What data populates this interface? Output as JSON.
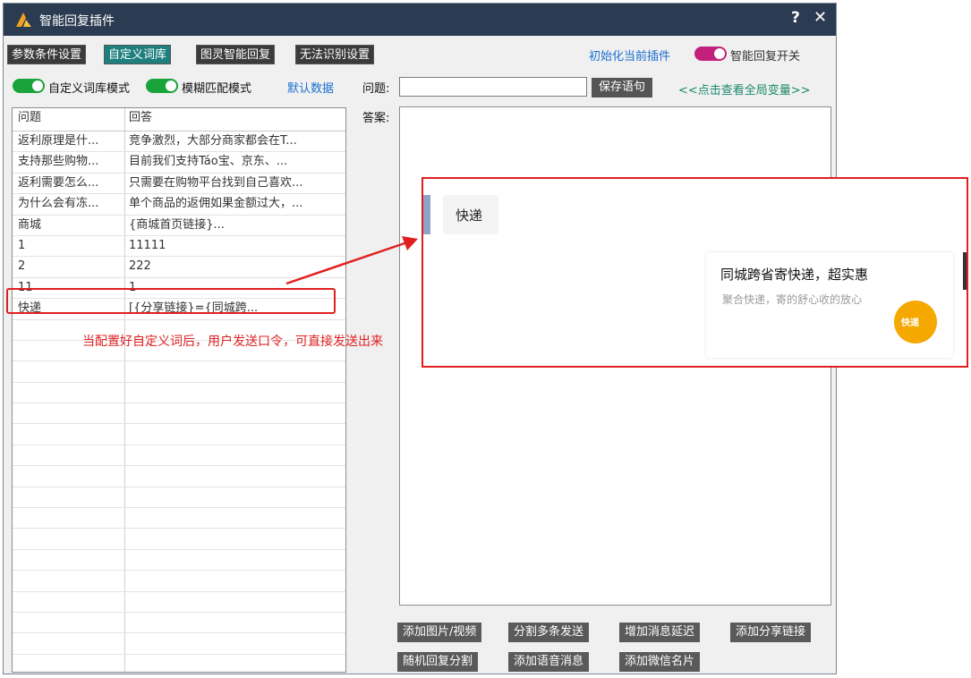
{
  "window": {
    "title": "智能回复插件",
    "help_glyph": "?",
    "close_glyph": "✕"
  },
  "tabs": [
    {
      "label": "参数条件设置",
      "active": false
    },
    {
      "label": "自定义词库",
      "active": true
    },
    {
      "label": "图灵智能回复",
      "active": false
    },
    {
      "label": "无法识别设置",
      "active": false
    }
  ],
  "header_right": {
    "init_link": "初始化当前插件",
    "smart_reply_label": "智能回复开关"
  },
  "modes": {
    "custom_mode": "自定义词库模式",
    "fuzzy_mode": "模糊匹配模式",
    "default_data": "默认数据"
  },
  "editor": {
    "question_label": "问题:",
    "question_value": "",
    "save_button": "保存语句",
    "global_vars_link": "<<点击查看全局变量>>",
    "answer_label": "答案:",
    "answer_value": ""
  },
  "table": {
    "headers": [
      "问题",
      "回答"
    ],
    "rows": [
      [
        "返利原理是什...",
        "竞争激烈，大部分商家都会在T..."
      ],
      [
        "支持那些购物...",
        "目前我们支持Táo宝、京东、..."
      ],
      [
        "返利需要怎么...",
        "只需要在购物平台找到自己喜欢..."
      ],
      [
        "为什么会有冻...",
        "单个商品的返佣如果金额过大，..."
      ],
      [
        "商城",
        "{商城首页链接}..."
      ],
      [
        "1",
        "11111"
      ],
      [
        "2",
        "222"
      ],
      [
        "11",
        "1"
      ],
      [
        "快递",
        "[{分享链接}={同城跨..."
      ]
    ],
    "empty_rows": 17
  },
  "buttons_row1": [
    "添加图片/视频",
    "分割多条发送",
    "增加消息延迟",
    "添加分享链接"
  ],
  "buttons_row2": [
    "随机回复分割",
    "添加语音消息",
    "添加微信名片"
  ],
  "annotation": "当配置好自定义词后，用户发送口令，可直接发送出来",
  "preview": {
    "message": "快递",
    "card_title": "同城跨省寄快递，超实惠",
    "card_desc": "聚合快递，寄的舒心收的放心",
    "card_logo_text": "快递"
  },
  "colors": {
    "titlebar": "#2b3b52",
    "tab_active": "#1f7f7f",
    "tab": "#3b3b3b",
    "toggle_green": "#1aa33a",
    "toggle_pink": "#c2207a",
    "link_blue": "#1a6fd0",
    "annotation_red": "#e02020",
    "card_logo": "#f5a800"
  }
}
